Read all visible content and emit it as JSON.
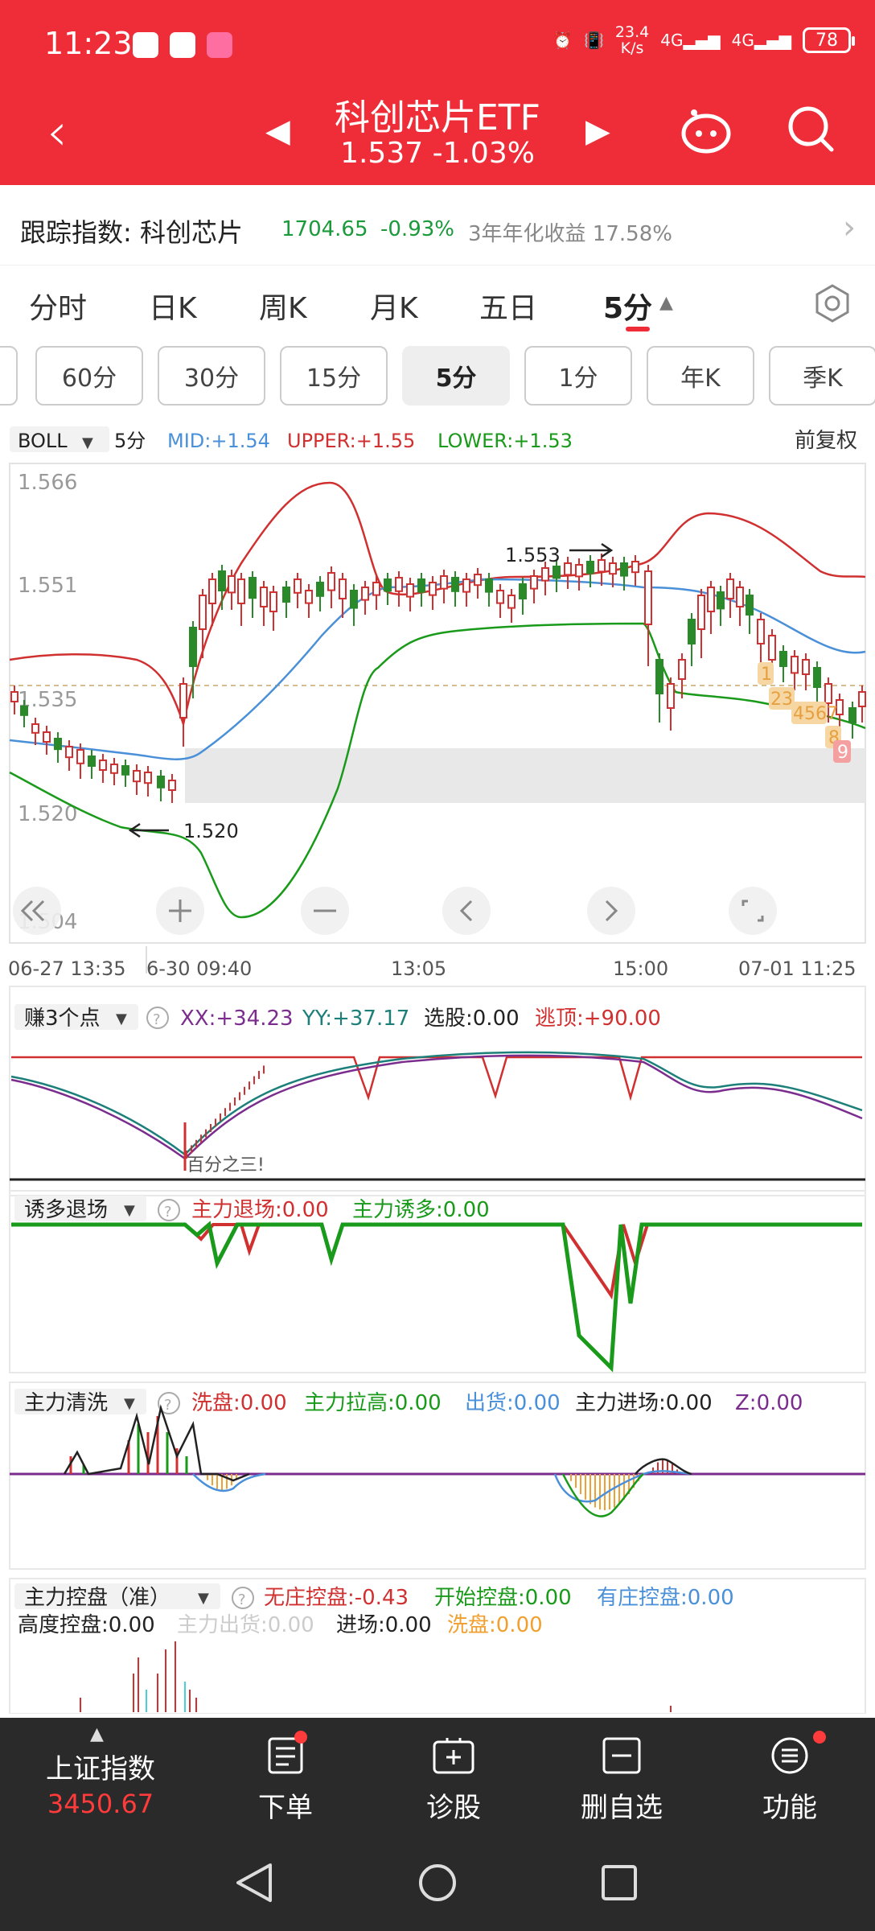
{
  "status_bar": {
    "time": "11:23",
    "net_speed_value": "23.4",
    "net_speed_unit": "K/s",
    "net1": "4G",
    "net2": "4G",
    "battery": "78"
  },
  "header": {
    "title": "科创芯片ETF",
    "price": "1.537",
    "change": "-1.03%"
  },
  "tracking": {
    "label": "跟踪指数: 科创芯片",
    "value": "1704.65",
    "change": "-0.93%",
    "annual": "3年年化收益 17.58%"
  },
  "ktabs": [
    "分时",
    "日K",
    "周K",
    "月K",
    "五日",
    "5分"
  ],
  "periods": [
    "60分",
    "30分",
    "15分",
    "5分",
    "1分",
    "年K",
    "季K"
  ],
  "boll": {
    "name": "BOLL",
    "period": "5分",
    "mid": "MID:+1.54",
    "upper": "UPPER:+1.55",
    "lower": "LOWER:+1.53",
    "adjust": "前复权"
  },
  "price_axis": [
    "1.566",
    "1.551",
    "1.535",
    "1.520",
    "1.504"
  ],
  "annotations": {
    "high": "1.553",
    "low": "1.520"
  },
  "time_axis": [
    "06-27 13:35",
    "6-30 09:40",
    "13:05",
    "15:00",
    "07-01 11:25"
  ],
  "tags": [
    "1",
    "23",
    "4567",
    "8",
    "9"
  ],
  "ind1": {
    "name": "赚3个点",
    "xx": "XX:+34.23",
    "yy": "YY:+37.17",
    "pick": "选股:0.00",
    "top": "逃顶:+90.00",
    "note": "百分之三!"
  },
  "ind2": {
    "name": "诱多退场",
    "exit": "主力退场:0.00",
    "lure": "主力诱多:0.00"
  },
  "ind3": {
    "name": "主力清洗",
    "wash": "洗盘:0.00",
    "pull": "主力拉高:0.00",
    "ship": "出货:0.00",
    "enter": "主力进场:0.00",
    "z": "Z:0.00"
  },
  "ind4": {
    "name": "主力控盘（准）",
    "none": "无庄控盘:-0.43",
    "start": "开始控盘:0.00",
    "has": "有庄控盘:0.00",
    "high": "高度控盘:0.00",
    "out": "主力出货:0.00",
    "in": "进场:0.00",
    "wash": "洗盘:0.00"
  },
  "bottom_nav": {
    "index_name": "上证指数",
    "index_value": "3450.67",
    "items": [
      "下单",
      "诊股",
      "删自选",
      "功能"
    ]
  },
  "colors": {
    "red": "#ef2d38",
    "green": "#1a9a1a",
    "blue": "#4a90d9",
    "purple": "#7b2d8e",
    "orange": "#f0a030"
  }
}
